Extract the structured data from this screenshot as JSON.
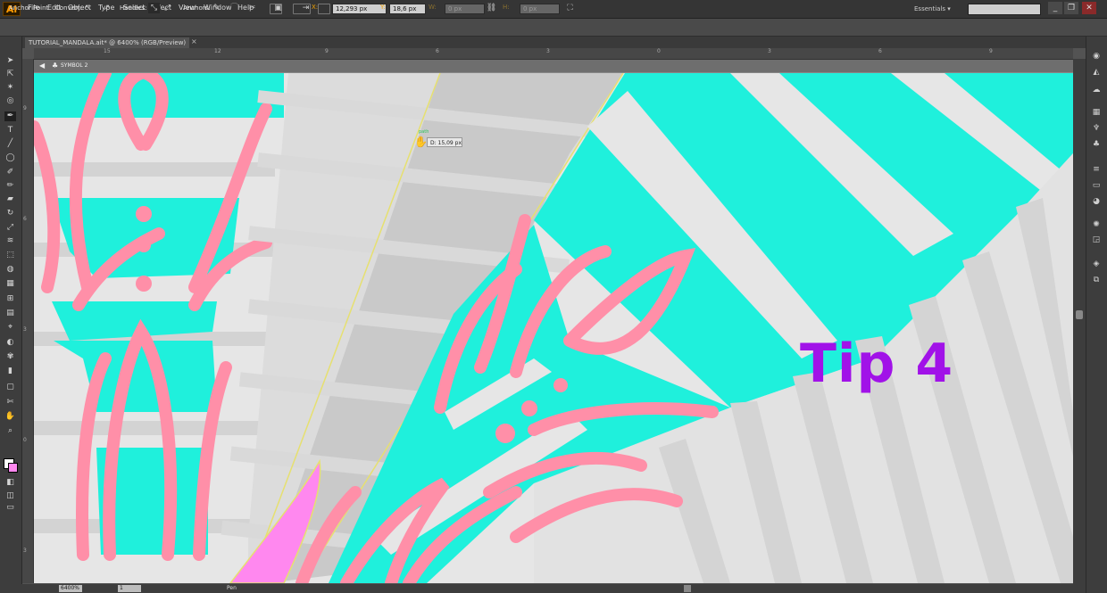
{
  "menubar": {
    "logo": "Ai",
    "items": [
      "File",
      "Edit",
      "Object",
      "Type",
      "Select",
      "Effect",
      "View",
      "Window",
      "Help"
    ],
    "workspace": "Essentials",
    "window_buttons": [
      "_",
      "❐",
      "✕"
    ]
  },
  "controlbar": {
    "tool_name": "Anchor Point",
    "convert_label": "Convert:",
    "handles_label": "Handles:",
    "anchors_label": "Anchors:",
    "x_label": "X:",
    "x_value": "12,293 px",
    "y_label": "Y:",
    "y_value": "18,6 px",
    "w_label": "W:",
    "w_value": "0 px",
    "h_label": "H:",
    "h_value": "0 px"
  },
  "document": {
    "tab_title": "TUTORIAL_MANDALA.ait* @ 6400% (RGB/Preview)",
    "tab_close": "×",
    "isolation_label": "SYMBOL 2"
  },
  "rulers": {
    "h_ticks": [
      "15",
      "12",
      "9",
      "6",
      "3",
      "0",
      "3",
      "6",
      "9"
    ],
    "v_ticks": [
      "9",
      "6",
      "3",
      "0",
      "3",
      "6"
    ]
  },
  "canvas": {
    "tip_label": "Tip 4",
    "path_hint": "path",
    "measure_tooltip": "D: 15,09 px",
    "colors": {
      "turquoise": "#1ff0dc",
      "pink": "#ff8fa8",
      "light_gray": "#e6e6e6",
      "mid_gray": "#c9c9c9",
      "magenta_selection": "#ff88ef",
      "tip_purple": "#a112e8"
    }
  },
  "statusbar": {
    "zoom": "6400%",
    "artboard": "1",
    "tool_status": "Pen"
  },
  "tools": [
    "selection-tool",
    "direct-selection-tool",
    "magic-wand-tool",
    "lasso-tool",
    "pen-tool",
    "type-tool",
    "line-tool",
    "ellipse-tool",
    "paintbrush-tool",
    "pencil-tool",
    "eraser-tool",
    "rotate-tool",
    "scale-tool",
    "width-tool",
    "free-transform-tool",
    "shape-builder-tool",
    "perspective-grid-tool",
    "mesh-tool",
    "gradient-tool",
    "eyedropper-tool",
    "blend-tool",
    "symbol-sprayer-tool",
    "column-graph-tool",
    "artboard-tool",
    "slice-tool",
    "hand-tool",
    "zoom-tool"
  ]
}
